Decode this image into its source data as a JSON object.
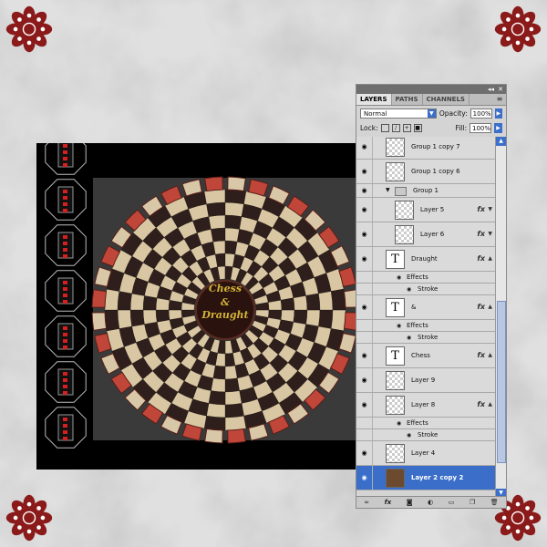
{
  "panel": {
    "tabs": [
      "LAYERS",
      "PATHS",
      "CHANNELS"
    ],
    "active_tab": "LAYERS",
    "blend_mode": "Normal",
    "opacity_label": "Opacity:",
    "opacity_value": "100%",
    "lock_label": "Lock:",
    "fill_label": "Fill:",
    "fill_value": "100%"
  },
  "layers": [
    {
      "name": "Group 1 copy 7",
      "kind": "group-smart",
      "fx": false
    },
    {
      "name": "Group 1 copy 6",
      "kind": "group-smart",
      "fx": false
    },
    {
      "name": "Group 1",
      "kind": "folder",
      "fx": false
    },
    {
      "name": "Layer 5",
      "kind": "pixel",
      "indent": true,
      "fx": true
    },
    {
      "name": "Layer 6",
      "kind": "pixel",
      "indent": true,
      "fx": true
    },
    {
      "name": "Draught",
      "kind": "text",
      "fx": true
    },
    {
      "name": "Effects",
      "kind": "effects"
    },
    {
      "name": "Stroke",
      "kind": "effect-item"
    },
    {
      "name": "&",
      "kind": "text",
      "fx": true
    },
    {
      "name": "Effects",
      "kind": "effects"
    },
    {
      "name": "Stroke",
      "kind": "effect-item"
    },
    {
      "name": "Chess",
      "kind": "text",
      "fx": true
    },
    {
      "name": "Layer 9",
      "kind": "pixel",
      "fx": false
    },
    {
      "name": "Layer 8",
      "kind": "pixel",
      "fx": true
    },
    {
      "name": "Effects",
      "kind": "effects"
    },
    {
      "name": "Stroke",
      "kind": "effect-item"
    },
    {
      "name": "Layer 4",
      "kind": "pixel",
      "fx": false
    },
    {
      "name": "Layer 2 copy 2",
      "kind": "image",
      "fx": false,
      "selected": true
    }
  ],
  "board": {
    "center_text": [
      "Chess",
      "&",
      "Draught"
    ]
  },
  "icons": {
    "eye": "eye-icon",
    "fx": "fx-icon",
    "bottom": [
      "link-icon",
      "fx-icon",
      "mask-icon",
      "adjustment-icon",
      "folder-icon",
      "new-layer-icon",
      "trash-icon"
    ]
  },
  "colors": {
    "flower": "#8b1a1a",
    "board_light": "#d9c7a3",
    "board_dark": "#2e1f1c",
    "rim": "#c0463a",
    "title_gold": "#d4b437",
    "selection": "#3a6ec9"
  }
}
